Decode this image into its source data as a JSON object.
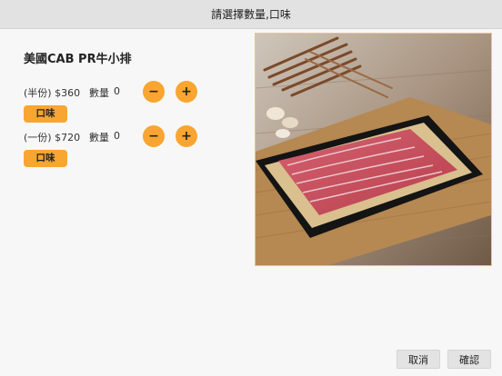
{
  "dialog": {
    "title": "請選擇數量,口味",
    "product_name": "美國CAB PR牛小排",
    "options": [
      {
        "price_label": "(半份) $360",
        "qty_label": "數量",
        "qty_value": "0",
        "minus_label": "−",
        "plus_label": "+",
        "flavor_label": "口味"
      },
      {
        "price_label": "(一份) $720",
        "qty_label": "數量",
        "qty_value": "0",
        "minus_label": "−",
        "plus_label": "+",
        "flavor_label": "口味"
      }
    ],
    "cancel_label": "取消",
    "confirm_label": "確認"
  },
  "colors": {
    "accent": "#f9a531",
    "title_bar": "#e2e2e2",
    "background": "#f7f7f7"
  }
}
